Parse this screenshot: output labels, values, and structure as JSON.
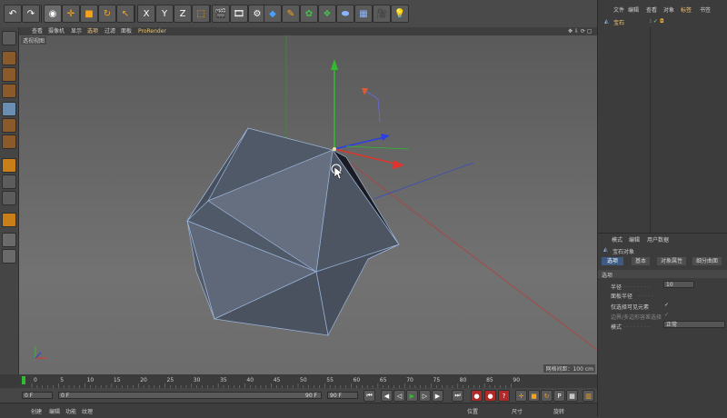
{
  "toolbar": {
    "undo_icon": "undo-icon",
    "redo_icon": "redo-icon",
    "axis_x": "X",
    "axis_y": "Y",
    "axis_z": "Z"
  },
  "viewport": {
    "menu": [
      "查看",
      "摄像机",
      "显示",
      "选项",
      "过滤",
      "面板",
      "ProRender"
    ],
    "label": "透视视图",
    "status": "网格间距：100 cm"
  },
  "timeline": {
    "ticks": [
      "0",
      "5",
      "10",
      "15",
      "20",
      "25",
      "30",
      "35",
      "40",
      "45",
      "50",
      "55",
      "60",
      "65",
      "70",
      "75",
      "80",
      "85",
      "90"
    ],
    "current_frame": "0 F",
    "start_frame": "0 F",
    "range_start": "0 F",
    "range_end": "90 F",
    "end_frame": "90 F",
    "end_frame2": "0 F"
  },
  "bottom": {
    "tabs": [
      "创建",
      "编辑",
      "功能",
      "纹理"
    ],
    "coord_labels": [
      "位置",
      "尺寸",
      "旋转"
    ]
  },
  "object_manager": {
    "menu": [
      "文件",
      "编辑",
      "查看",
      "对象",
      "标签",
      "书签"
    ],
    "object_name": "宝石"
  },
  "attributes": {
    "menu": [
      "模式",
      "编辑",
      "用户数据"
    ],
    "object_title": "宝石对象",
    "tabs": [
      "选项",
      "基本",
      "对象属性",
      "细分曲面"
    ],
    "section": "选项",
    "rows": [
      {
        "label": "半径",
        "value": "10"
      },
      {
        "label": "面板半径",
        "value": ""
      },
      {
        "label": "仅选择可见元素",
        "value": "✓"
      },
      {
        "label": "边界/多边形容差选择",
        "value": "✓"
      },
      {
        "label": "模式",
        "value": "正常"
      }
    ]
  },
  "colors": {
    "axis_x": "#e2332a",
    "axis_y": "#2fbd2f",
    "axis_z": "#2a40e0",
    "selection": "#8fb4e6"
  }
}
